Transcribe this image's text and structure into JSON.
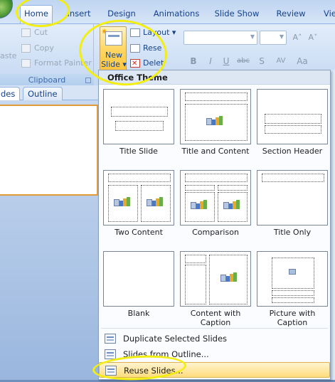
{
  "ribbon_tabs": [
    "Home",
    "Insert",
    "Design",
    "Animations",
    "Slide Show",
    "Review",
    "Vie"
  ],
  "active_tab": "Home",
  "clipboard": {
    "paste_label": "aste",
    "cut_label": "Cut",
    "copy_label": "Copy",
    "format_painter_label": "Format Painter",
    "group_label": "Clipboard"
  },
  "slides_group": {
    "new_slide_line1": "New",
    "new_slide_line2": "Slide ▾",
    "layout_label": "Layout ▾",
    "reset_label": "Rese",
    "delete_label": "Delet"
  },
  "font_group": {
    "bold": "B",
    "italic": "I",
    "underline": "U",
    "strike": "abc",
    "shadow": "S",
    "spacing": "AV",
    "case": "Aa",
    "grow": "A",
    "shrink": "A"
  },
  "panel_tabs": {
    "slides": "des",
    "outline": "Outline"
  },
  "gallery": {
    "header": "Office Theme",
    "layouts": [
      "Title Slide",
      "Title and Content",
      "Section Header",
      "Two Content",
      "Comparison",
      "Title Only",
      "Blank",
      "Content with Caption",
      "Picture with Caption"
    ],
    "menu": {
      "duplicate": "Duplicate Selected Slides",
      "outline": "Slides from Outline...",
      "reuse": "Reuse Slides..."
    }
  },
  "colors": {
    "highlight": "#f2ee12",
    "ribbon_text": "#15428b",
    "hover_fill": "#ffdd7e"
  }
}
